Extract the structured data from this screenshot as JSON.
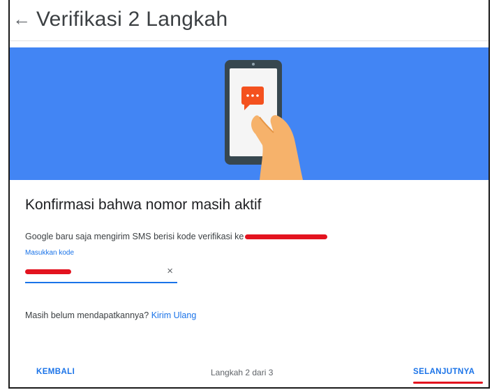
{
  "header": {
    "back_icon": "←",
    "title": "Verifikasi 2 Langkah"
  },
  "banner": {
    "background": "#4285f4",
    "illustration": "phone-with-sms-icon"
  },
  "content": {
    "title": "Konfirmasi bahwa nomor masih aktif",
    "description": "Google baru saja mengirim SMS berisi kode verifikasi ke",
    "code_field": {
      "label": "Masukkan kode",
      "clear_icon": "×"
    },
    "resend_prompt": "Masih belum mendapatkannya?",
    "resend_link": "Kirim Ulang"
  },
  "footer": {
    "back_label": "KEMBALI",
    "step_text": "Langkah 2 dari 3",
    "next_label": "SELANJUTNYA"
  },
  "colors": {
    "accent": "#1a73e8",
    "banner": "#4285f4",
    "redaction": "#e3131f"
  }
}
